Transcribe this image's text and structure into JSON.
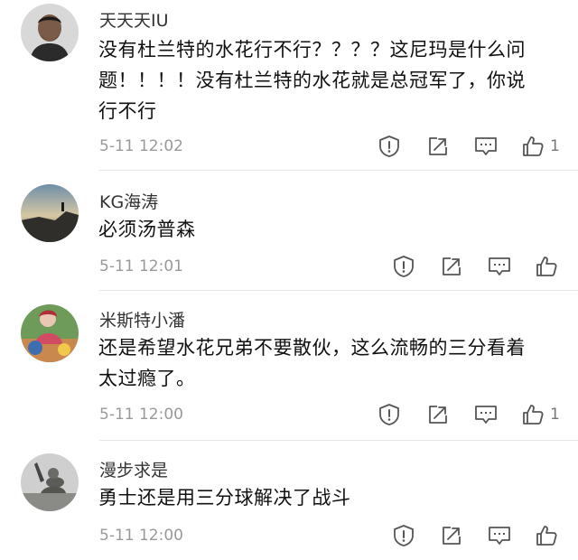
{
  "comments": [
    {
      "username": "天天天IU",
      "text_line1": "没有杜兰特的水花行不行？？？？这尼玛是什么问",
      "text_line2": "题！！！！没有杜兰特的水花就是总冠军了，你说",
      "text_line3": "行不行",
      "time": "5-11 12:02",
      "likes": "1",
      "avatar": "portrait-man-avatar"
    },
    {
      "username": "KG海涛",
      "text_line1": "必须汤普森",
      "time": "5-11 12:01",
      "likes": "",
      "avatar": "landscape-sunset-avatar"
    },
    {
      "username": "米斯特小潘",
      "text_line1": "还是希望水花兄弟不要散伙，这么流畅的三分看着",
      "text_line2": "太过瘾了。",
      "time": "5-11 12:00",
      "likes": "1",
      "avatar": "colorful-cartoon-avatar"
    },
    {
      "username": "漫步求是",
      "text_line1": "勇士还是用三分球解决了战斗",
      "time": "5-11 12:00",
      "likes": "",
      "avatar": "soldier-photo-avatar"
    }
  ],
  "icons": {
    "report": "exclamation-circle-icon",
    "share": "share-arrow-icon",
    "reply": "chat-bubble-icon",
    "like": "thumbs-up-icon"
  },
  "colors": {
    "icon": "#555555",
    "time": "#999999",
    "divider": "#e6e6e6"
  }
}
